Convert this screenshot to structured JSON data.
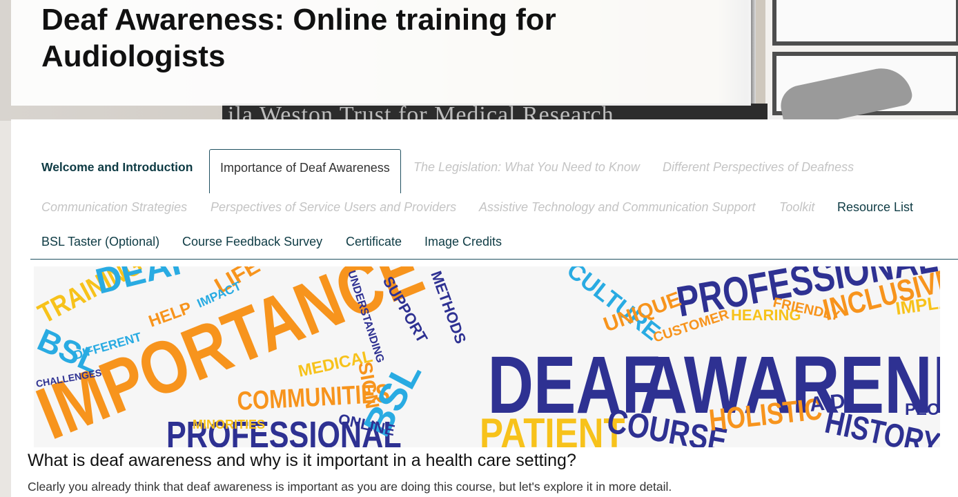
{
  "page": {
    "title": "Deaf Awareness: Online training for Audiologists",
    "hero_plaque_text": "ila Weston Trust for Medical Research"
  },
  "nav": {
    "row1": [
      {
        "label": "Welcome and Introduction",
        "state": "visited"
      },
      {
        "label": "Importance of Deaf Awareness",
        "state": "current"
      },
      {
        "label": "The Legislation: What You Need to Know",
        "state": "locked"
      },
      {
        "label": "Different Perspectives of Deafness",
        "state": "locked"
      }
    ],
    "row2": [
      {
        "label": "Communication Strategies",
        "state": "locked"
      },
      {
        "label": "Perspectives of Service Users and Providers",
        "state": "locked"
      },
      {
        "label": "Assistive Technology and Communication Support",
        "state": "locked"
      },
      {
        "label": "Toolkit",
        "state": "locked"
      },
      {
        "label": "Resource List",
        "state": "available"
      }
    ],
    "row3": [
      {
        "label": "BSL Taster (Optional)",
        "state": "available"
      },
      {
        "label": "Course Feedback Survey",
        "state": "available"
      },
      {
        "label": "Certificate",
        "state": "available"
      },
      {
        "label": "Image Credits",
        "state": "available"
      }
    ]
  },
  "banner": {
    "words": {
      "importance": "IMPORTANCE",
      "deaf": "DEAF",
      "awareness": "AWARENESS",
      "professional": "PROFESSIONAL",
      "communities": "COMMUNITIES",
      "training": "TRAINING",
      "bsl": "BSL",
      "patient": "PATIENT",
      "course": "COURSE",
      "holistic": "HOLISTIC",
      "history": "HISTORY",
      "inclusive": "INCLUSIVE",
      "culture": "CULTURE",
      "unique": "UNIQUE",
      "people": "PEOPLE",
      "implant": "IMPLANT",
      "friendly": "FRIENDLY",
      "hearing": "HEARING",
      "medical": "MEDICAL",
      "online": "ONLINE",
      "support": "SUPPORT",
      "life": "LIFE",
      "sign": "SIGN",
      "help": "HELP",
      "impact": "IMPACT",
      "minorities": "MINORITIES",
      "customer": "CUSTOMER",
      "different": "DIFFERENT",
      "aid": "AID",
      "understanding": "UNDERSTANDING",
      "methods": "METHODS",
      "challenges": "CHALLENGES"
    },
    "colors": {
      "orange": "#f7941d",
      "blue": "#2e3192",
      "lightblue": "#29abe2",
      "yellow": "#f7c21b"
    }
  },
  "content": {
    "heading": "What is deaf awareness and why is it important in a health care setting?",
    "intro": "Clearly you already think that deaf awareness is important as you are doing this course, but let's explore it in more detail."
  },
  "colors": {
    "nav_text": "#0e3b44",
    "locked_text": "#c4c4c4",
    "rule": "#1f5060"
  }
}
